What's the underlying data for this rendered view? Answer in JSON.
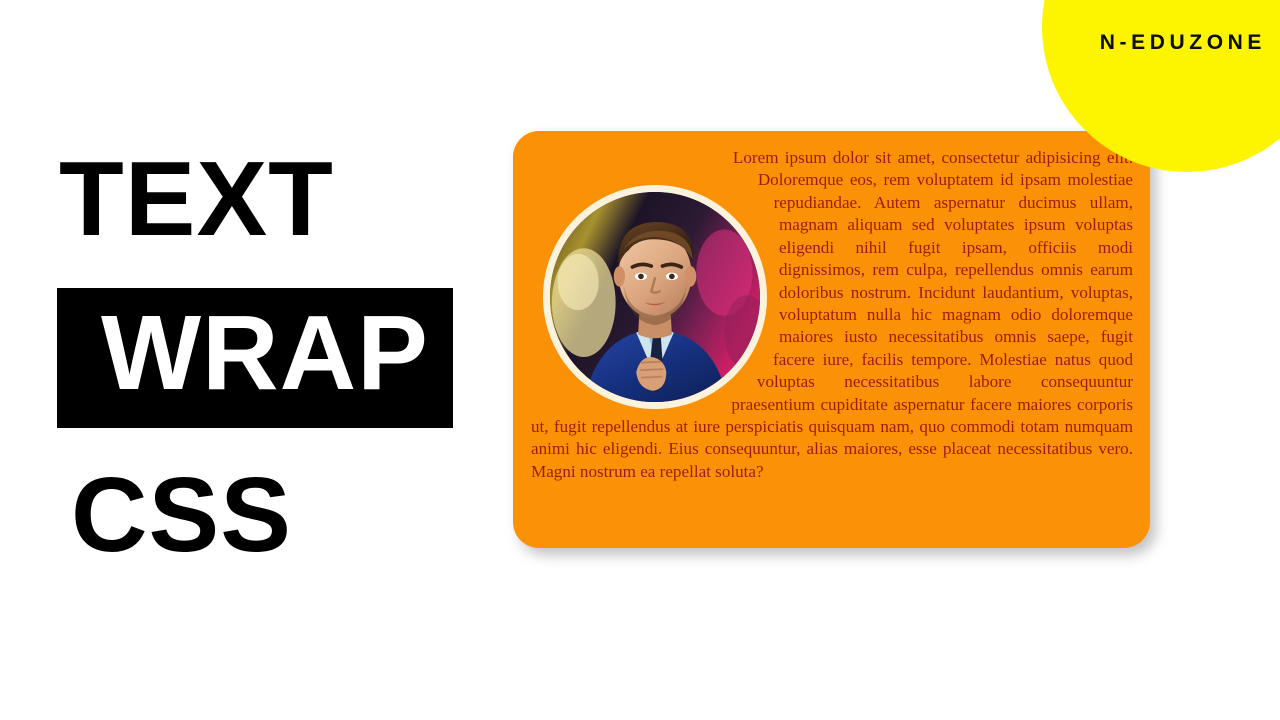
{
  "brand": {
    "name": "N-EDUZONE",
    "badge_color": "#fdf500",
    "text_color": "#0d0d0d"
  },
  "title": {
    "line1": "TEXT",
    "line2": "WRAP",
    "line3": "CSS",
    "text_color": "#000000",
    "highlight_background": "#000000",
    "highlight_text_color": "#ffffff"
  },
  "card": {
    "background_color": "#fb9107",
    "text_color": "#9e1b06",
    "avatar": {
      "alt": "portrait of man in blue suit adjusting tie",
      "ring_color": "#fdf3dd"
    },
    "paragraph": "Lorem ipsum dolor sit amet, consectetur adipisicing elit. Doloremque eos, rem voluptatem id ipsam molestiae repudiandae. Autem aspernatur ducimus ullam, magnam aliquam sed voluptates ipsum voluptas eligendi nihil fugit ipsam, officiis modi dignissimos, rem culpa, repellendus omnis earum doloribus nostrum. Incidunt laudantium, voluptas, voluptatum nulla hic magnam odio doloremque maiores iusto necessitatibus omnis saepe, fugit facere iure, facilis tempore. Molestiae natus quod voluptas necessitatibus labore consequuntur praesentium cupiditate aspernatur facere maiores corporis ut, fugit repellendus at iure perspiciatis quisquam nam, quo commodi totam numquam animi hic eligendi. Eius consequuntur, alias maiores, esse placeat necessitatibus vero. Magni nostrum ea repellat soluta?"
  },
  "page": {
    "background_color": "#ffffff"
  }
}
